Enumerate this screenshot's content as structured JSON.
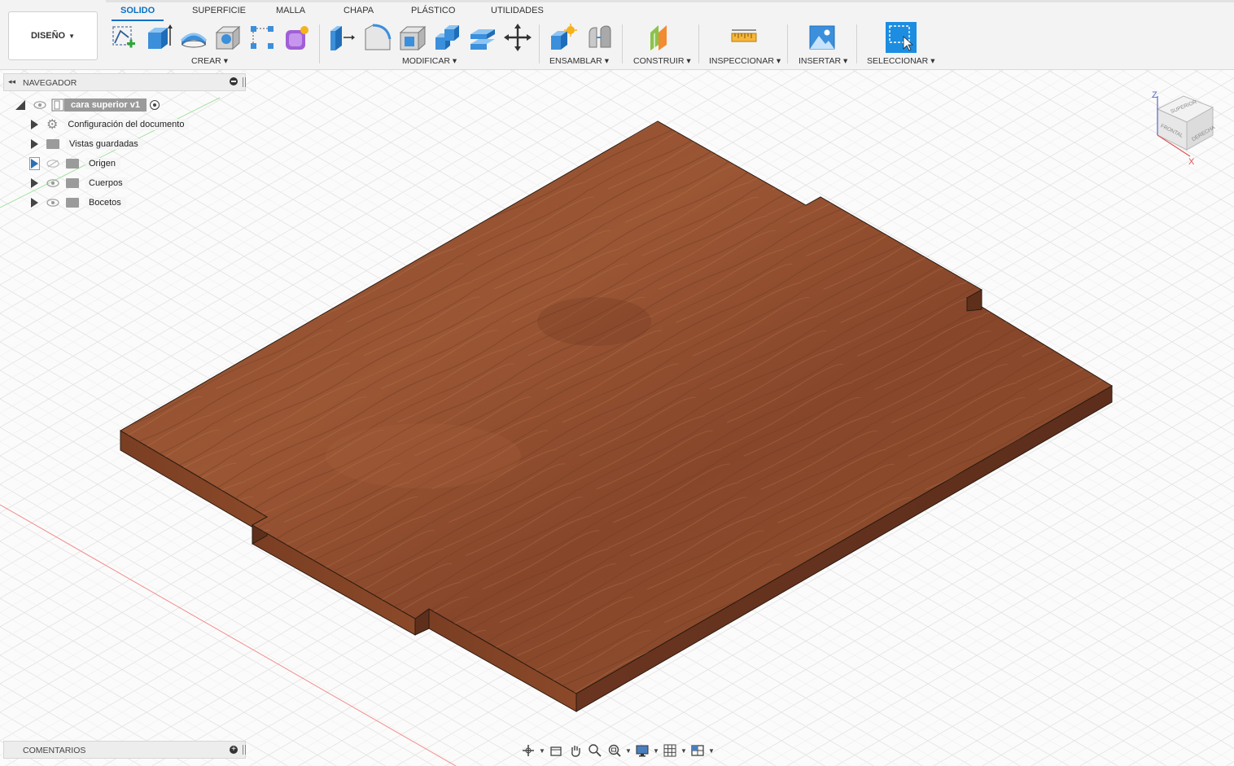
{
  "toolbar": {
    "workspace": "DISEÑO",
    "tabs": [
      "SOLIDO",
      "SUPERFICIE",
      "MALLA",
      "CHAPA",
      "PLÁSTICO",
      "UTILIDADES"
    ],
    "groups": [
      "CREAR",
      "MODIFICAR",
      "ENSAMBLAR",
      "CONSTRUIR",
      "INSPECCIONAR",
      "INSERTAR",
      "SELECCIONAR"
    ],
    "accent": "#0a70c4"
  },
  "navigator": {
    "title": "NAVEGADOR",
    "root": "cara superior v1",
    "items": [
      "Configuración del documento",
      "Vistas guardadas",
      "Origen",
      "Cuerpos",
      "Bocetos"
    ]
  },
  "comments": {
    "title": "COMENTARIOS"
  },
  "viewcube": {
    "faces": [
      "SUPERIOR",
      "FRONTAL",
      "DERECHA"
    ],
    "axes": [
      "Z",
      "X"
    ]
  },
  "model": {
    "material_color": "#8c4a2c"
  }
}
